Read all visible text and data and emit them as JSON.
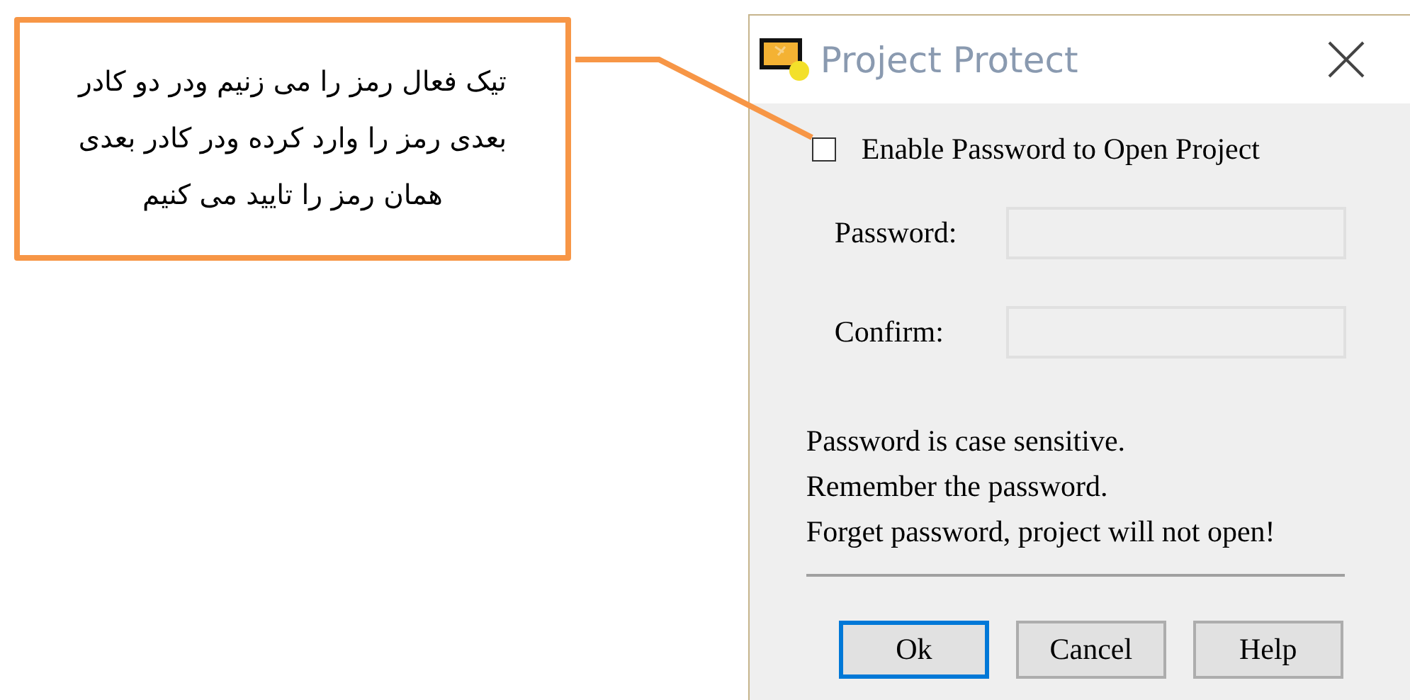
{
  "annotation": {
    "text": "تیک فعال رمز را می زنیم ودر دو کادر بعدی رمز را وارد کرده ودر کادر بعدی همان رمز را تایید می کنیم"
  },
  "dialog": {
    "title": "Project Protect",
    "checkbox": {
      "label": "Enable Password to Open Project",
      "checked": false
    },
    "fields": [
      {
        "label": "Password:"
      },
      {
        "label": "Confirm:"
      }
    ],
    "notes": [
      "Password is case sensitive.",
      "Remember the password.",
      "Forget password, project will not open!"
    ],
    "buttons": [
      {
        "label": "Ok",
        "default": true
      },
      {
        "label": "Cancel",
        "default": false
      },
      {
        "label": "Help",
        "default": false
      }
    ]
  }
}
